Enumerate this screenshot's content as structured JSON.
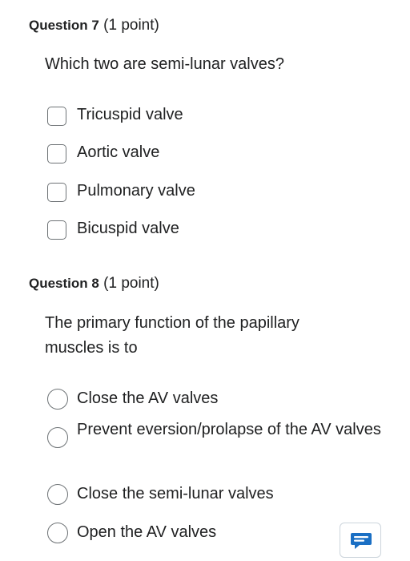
{
  "questions": [
    {
      "number_label": "Question 7",
      "points_label": "(1 point)",
      "text": "Which two are semi-lunar valves?",
      "input_type": "checkbox",
      "options": [
        {
          "label": "Tricuspid valve",
          "selected": false
        },
        {
          "label": "Aortic valve",
          "selected": false
        },
        {
          "label": "Pulmonary valve",
          "selected": false
        },
        {
          "label": "Bicuspid valve",
          "selected": false
        }
      ]
    },
    {
      "number_label": "Question 8",
      "points_label": "(1 point)",
      "text": "The primary function of the papillary muscles is to",
      "input_type": "radio",
      "options": [
        {
          "label": "Close the AV valves",
          "selected": false
        },
        {
          "label": "Prevent eversion/prolapse of the AV valves",
          "selected": false
        },
        {
          "label": "Close the semi-lunar valves",
          "selected": false
        },
        {
          "label": "Open the AV valves",
          "selected": false
        }
      ]
    }
  ],
  "feedback_button": {
    "icon": "chat-feedback-icon",
    "color": "#1a6fc4"
  },
  "colors": {
    "text": "#202122",
    "control_border": "#6e7376"
  }
}
